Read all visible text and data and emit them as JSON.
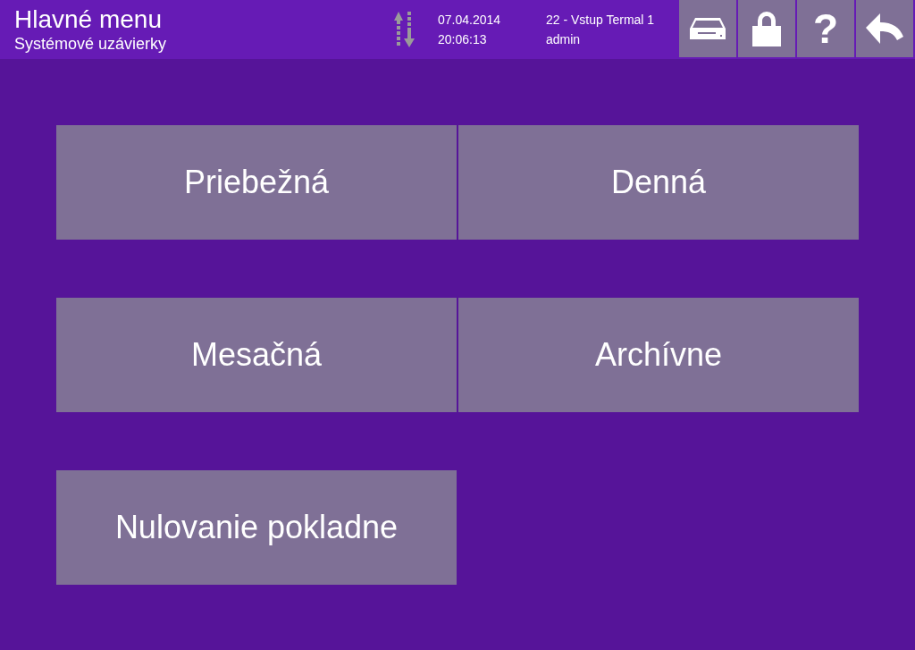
{
  "header": {
    "title": "Hlavné menu",
    "subtitle": "Systémové uzávierky",
    "date": "07.04.2014",
    "time": "20:06:13",
    "station": "22 - Vstup Termal 1",
    "user": "admin"
  },
  "toolbar": [
    {
      "kind": "drawer"
    },
    {
      "kind": "lock"
    },
    {
      "kind": "help",
      "label": "?"
    },
    {
      "kind": "back"
    }
  ],
  "tiles": [
    [
      "Priebežná",
      "Denná"
    ],
    [
      "Mesačná",
      "Archívne"
    ],
    [
      "Nulovanie pokladne"
    ]
  ]
}
